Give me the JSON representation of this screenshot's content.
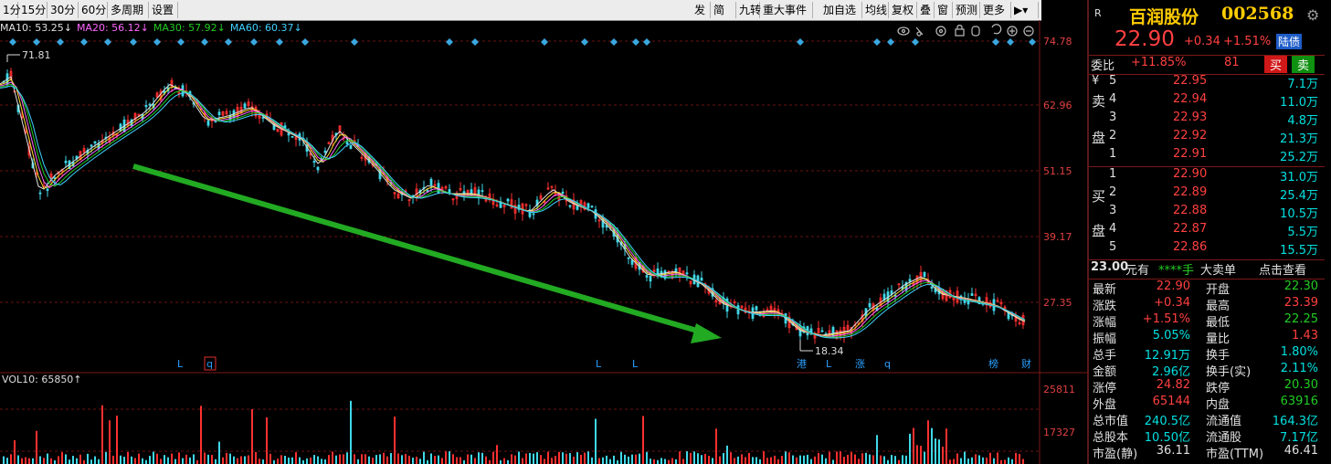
{
  "toolbar": {
    "left_items": [
      "1分",
      "15分",
      "30分",
      "60分",
      "多周期",
      "设置"
    ],
    "right_items": [
      "发",
      "简",
      "九转",
      "重大事件",
      "加自选",
      "均线",
      "复权",
      "叠",
      "窗",
      "预测",
      "更多"
    ]
  },
  "ma_legend": [
    {
      "label": "MA10: 53.25↓",
      "color": "#e0e0e0"
    },
    {
      "label": "MA20: 56.12↓",
      "color": "#ff66ff"
    },
    {
      "label": "MA30: 57.92↓",
      "color": "#22cc22"
    },
    {
      "label": "MA60: 60.37↓",
      "color": "#40d0ff"
    }
  ],
  "chart": {
    "price_axis": [
      "74.78",
      "62.96",
      "51.15",
      "39.17",
      "27.35"
    ],
    "high_label": "71.81",
    "low_label": "18.34",
    "volume_label": "VOL10: 65850↑",
    "volume_axis": [
      "25811",
      "17327"
    ],
    "event_markers": [
      "L",
      "q",
      "L",
      "L",
      "港",
      "L",
      "涨",
      "q",
      "榜",
      "财"
    ]
  },
  "stock": {
    "name": "百润股份",
    "code": "002568",
    "price": "22.90",
    "change": "+0.34",
    "change_pct": "+1.51%",
    "tag": "陆债",
    "header_letter": "R"
  },
  "order_ratio": {
    "label": "委比",
    "value": "+11.85%",
    "diff": "81",
    "buy_btn": "买",
    "sell_btn": "卖"
  },
  "sell_side_label": [
    "卖",
    "盘"
  ],
  "buy_side_label": [
    "买",
    "盘"
  ],
  "asks": [
    {
      "level": "5",
      "price": "22.95",
      "vol": "7.1万",
      "prefix": "¥"
    },
    {
      "level": "4",
      "price": "22.94",
      "vol": "11.0万",
      "prefix": ""
    },
    {
      "level": "3",
      "price": "22.93",
      "vol": "4.8万",
      "prefix": ""
    },
    {
      "level": "2",
      "price": "22.92",
      "vol": "21.3万",
      "prefix": ""
    },
    {
      "level": "1",
      "price": "22.91",
      "vol": "25.2万",
      "prefix": ""
    }
  ],
  "bids": [
    {
      "level": "1",
      "price": "22.90",
      "vol": "31.0万"
    },
    {
      "level": "2",
      "price": "22.89",
      "vol": "25.4万"
    },
    {
      "level": "3",
      "price": "22.88",
      "vol": "10.5万"
    },
    {
      "level": "4",
      "price": "22.87",
      "vol": "5.5万"
    },
    {
      "level": "5",
      "price": "22.86",
      "vol": "15.5万"
    }
  ],
  "big_order": {
    "price": "23.00",
    "unit": "元有",
    "hand": "****手",
    "label": "大卖单",
    "link": "点击查看"
  },
  "stats": [
    {
      "l1": "最新",
      "v1": "22.90",
      "c1": "red",
      "l2": "开盘",
      "v2": "22.30",
      "c2": "grn"
    },
    {
      "l1": "涨跌",
      "v1": "+0.34",
      "c1": "red",
      "l2": "最高",
      "v2": "23.39",
      "c2": "red"
    },
    {
      "l1": "涨幅",
      "v1": "+1.51%",
      "c1": "red",
      "l2": "最低",
      "v2": "22.25",
      "c2": "grn"
    },
    {
      "l1": "振幅",
      "v1": "5.05%",
      "c1": "cyan",
      "l2": "量比",
      "v2": "1.43",
      "c2": "red"
    },
    {
      "l1": "总手",
      "v1": "12.91万",
      "c1": "cyan",
      "l2": "换手",
      "v2": "1.80%",
      "c2": "cyan"
    },
    {
      "l1": "金额",
      "v1": "2.96亿",
      "c1": "cyan",
      "l2": "换手(实)",
      "v2": "2.11%",
      "c2": "cyan"
    },
    {
      "l1": "涨停",
      "v1": "24.82",
      "c1": "red",
      "l2": "跌停",
      "v2": "20.30",
      "c2": "grn"
    },
    {
      "l1": "外盘",
      "v1": "65144",
      "c1": "red",
      "l2": "内盘",
      "v2": "63916",
      "c2": "grn"
    },
    {
      "l1": "总市值",
      "v1": "240.5亿",
      "c1": "cyan",
      "l2": "流通值",
      "v2": "164.3亿",
      "c2": "cyan"
    },
    {
      "l1": "总股本",
      "v1": "10.50亿",
      "c1": "cyan",
      "l2": "流通股",
      "v2": "7.17亿",
      "c2": "cyan"
    },
    {
      "l1": "市盈(静)",
      "v1": "36.11",
      "c1": "wht",
      "l2": "市盈(TTM)",
      "v2": "46.41",
      "c2": "wht"
    }
  ]
}
